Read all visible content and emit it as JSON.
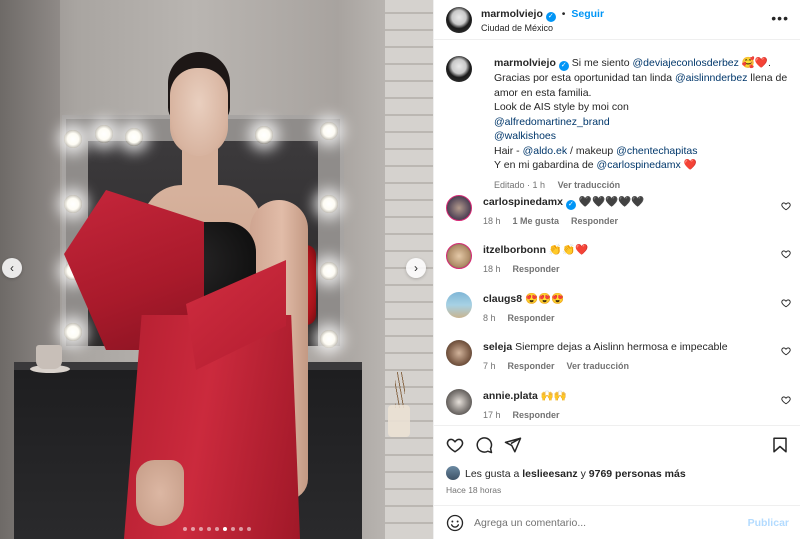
{
  "post": {
    "username": "marmolviejo",
    "follow_label": "Seguir",
    "location": "Ciudad de México",
    "more_label": "•••",
    "carousel_dots": 9,
    "active_dot": 5
  },
  "caption": {
    "username": "marmolviejo",
    "segments": [
      {
        "t": "Si me siento "
      },
      {
        "t": "@deviajeconlosderbez",
        "m": true
      },
      {
        "t": " 🥰❤️.\nGracias por esta oportunidad tan linda "
      },
      {
        "t": "@aislinnderbez",
        "m": true
      },
      {
        "t": " llena de amor en esta familia.\nLook de AIS style by moi con\n"
      },
      {
        "t": "@alfredomartinez_brand",
        "m": true
      },
      {
        "t": "\n"
      },
      {
        "t": "@walkishoes",
        "m": true
      },
      {
        "t": "\nHair - "
      },
      {
        "t": "@aldo.ek",
        "m": true
      },
      {
        "t": " / makeup "
      },
      {
        "t": "@chentechapitas",
        "m": true
      },
      {
        "t": "\nY en mi gabardina de "
      },
      {
        "t": "@carlospinedamx",
        "m": true
      },
      {
        "t": " ❤️"
      }
    ],
    "edited": "Editado · 1 h",
    "translate": "Ver traducción"
  },
  "comments": [
    {
      "user": "carlospinedamx",
      "verified": true,
      "text": "🖤🖤🖤🖤🖤",
      "time": "18 h",
      "likes": "1 Me gusta",
      "action": "Responder"
    },
    {
      "user": "itzelborbonn",
      "verified": false,
      "text": "👏👏❤️",
      "time": "18 h",
      "likes": "",
      "action": "Responder"
    },
    {
      "user": "claugs8",
      "verified": false,
      "text": "😍😍😍",
      "time": "8 h",
      "likes": "",
      "action": "Responder"
    },
    {
      "user": "seleja",
      "verified": false,
      "text": "Siempre dejas a Aislinn hermosa e impecable",
      "time": "7 h",
      "likes": "",
      "action": "Responder",
      "translate": "Ver traducción"
    },
    {
      "user": "annie.plata",
      "verified": false,
      "text": "🙌🙌",
      "time": "17 h",
      "likes": "",
      "action": "Responder"
    }
  ],
  "likes_line": {
    "prefix": "Les gusta a ",
    "user": "leslieesanz",
    "middle": " y ",
    "count": "9769 personas más"
  },
  "time_ago": "Hace 18 horas",
  "composer": {
    "placeholder": "Agrega un comentario...",
    "publish": "Publicar"
  },
  "icons": {
    "like": "heart-icon",
    "comment": "comment-icon",
    "share": "share-icon",
    "save": "bookmark-icon",
    "emoji": "emoji-icon",
    "prev": "chevron-left-icon",
    "next": "chevron-right-icon"
  },
  "colors": {
    "accent": "#0095f6",
    "mention": "#00376b",
    "secondary_text": "#737373",
    "publish_disabled": "#b3dbff"
  }
}
